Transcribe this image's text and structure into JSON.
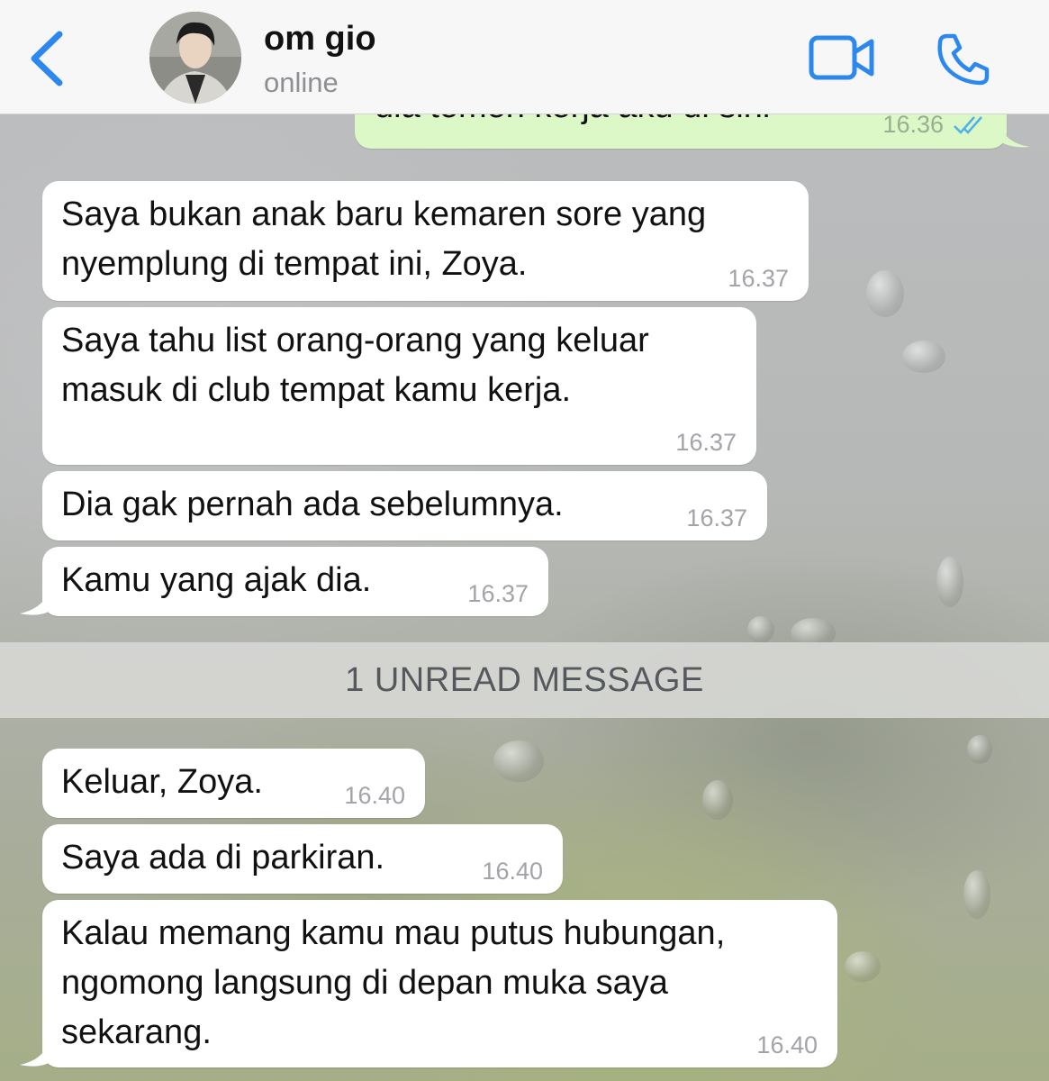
{
  "header": {
    "contact_name": "om gio",
    "status": "online",
    "back_icon": "chevron-left-icon",
    "video_icon": "video-camera-icon",
    "phone_icon": "phone-icon",
    "accent_color": "#2d88ee"
  },
  "messages": [
    {
      "direction": "outgoing",
      "text": "dia temen kerja aku di sini",
      "time": "16.36",
      "read_receipt": "double-check-icon"
    },
    {
      "direction": "incoming",
      "text": "Saya bukan anak baru kemaren sore yang\nnyemplung di tempat ini, Zoya.",
      "time": "16.37"
    },
    {
      "direction": "incoming",
      "text": "Saya tahu list orang-orang yang keluar\nmasuk di club tempat kamu kerja.",
      "time": "16.37"
    },
    {
      "direction": "incoming",
      "text": "Dia gak pernah ada sebelumnya.",
      "time": "16.37"
    },
    {
      "direction": "incoming",
      "text": "Kamu yang ajak dia.",
      "time": "16.37"
    },
    {
      "direction": "incoming",
      "text": "Keluar, Zoya.",
      "time": "16.40"
    },
    {
      "direction": "incoming",
      "text": "Saya ada di parkiran.",
      "time": "16.40"
    },
    {
      "direction": "incoming",
      "text": "Kalau memang kamu mau putus hubungan,\nngomong langsung di depan muka saya\nsekarang.",
      "time": "16.40"
    }
  ],
  "unread_banner": "1 UNREAD MESSAGE",
  "colors": {
    "incoming_bubble": "#ffffff",
    "outgoing_bubble": "#dcf8c6",
    "header_bg": "#f7f7f7"
  }
}
